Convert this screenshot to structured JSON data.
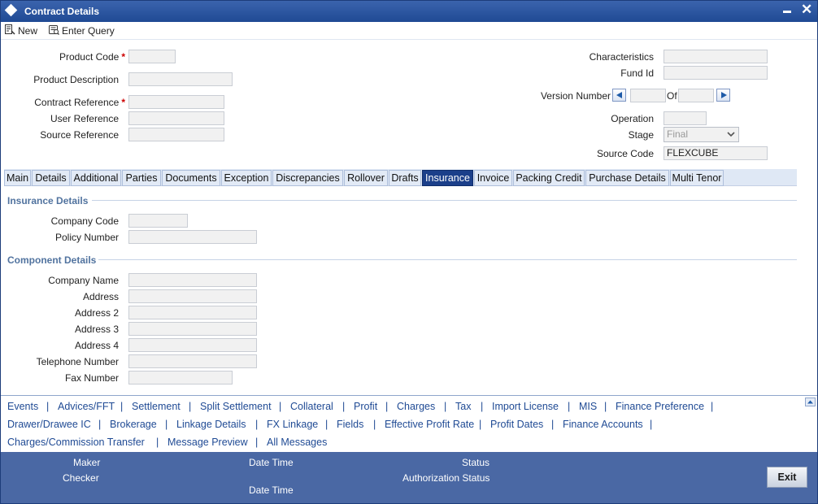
{
  "window": {
    "title": "Contract Details"
  },
  "toolbar": {
    "new_label": "New",
    "enter_query_label": "Enter Query"
  },
  "header": {
    "product_code": {
      "label": "Product Code",
      "required": "*",
      "value": ""
    },
    "product_description": {
      "label": "Product Description",
      "value": ""
    },
    "contract_reference": {
      "label": "Contract Reference",
      "required": "*",
      "value": ""
    },
    "user_reference": {
      "label": "User Reference",
      "value": ""
    },
    "source_reference": {
      "label": "Source Reference",
      "value": ""
    },
    "characteristics": {
      "label": "Characteristics",
      "value": ""
    },
    "fund_id": {
      "label": "Fund Id",
      "value": ""
    },
    "version_number": {
      "label": "Version Number",
      "of_label": "Of",
      "value": "",
      "total": ""
    },
    "operation": {
      "label": "Operation",
      "value": ""
    },
    "stage": {
      "label": "Stage",
      "value": "Final"
    },
    "source_code": {
      "label": "Source Code",
      "value": "FLEXCUBE"
    }
  },
  "tabs": [
    {
      "label": "Main"
    },
    {
      "label": "Details"
    },
    {
      "label": "Additional"
    },
    {
      "label": "Parties"
    },
    {
      "label": "Documents"
    },
    {
      "label": "Exception"
    },
    {
      "label": "Discrepancies"
    },
    {
      "label": "Rollover"
    },
    {
      "label": "Drafts"
    },
    {
      "label": "Insurance"
    },
    {
      "label": "Invoice"
    },
    {
      "label": "Packing Credit"
    },
    {
      "label": "Purchase Details"
    },
    {
      "label": "Multi Tenor"
    }
  ],
  "active_tab": "Insurance",
  "insurance": {
    "title": "Insurance Details",
    "company_code": {
      "label": "Company Code",
      "value": ""
    },
    "policy_number": {
      "label": "Policy Number",
      "value": ""
    }
  },
  "component": {
    "title": "Component Details",
    "company_name": {
      "label": "Company Name",
      "value": ""
    },
    "address": {
      "label": "Address",
      "value": ""
    },
    "address2": {
      "label": "Address 2",
      "value": ""
    },
    "address3": {
      "label": "Address 3",
      "value": ""
    },
    "address4": {
      "label": "Address 4",
      "value": ""
    },
    "telephone": {
      "label": "Telephone Number",
      "value": ""
    },
    "fax": {
      "label": "Fax Number",
      "value": ""
    }
  },
  "links": {
    "row1": [
      "Events",
      "Advices/FFT",
      "Settlement",
      "Split Settlement",
      "Collateral",
      "Profit",
      "Charges",
      "Tax",
      "Import License",
      "MIS",
      "Finance Preference"
    ],
    "row2": [
      "Drawer/Drawee IC",
      "Brokerage",
      "Linkage Details",
      "FX Linkage",
      "Fields",
      "Effective Profit Rate",
      "Profit Dates",
      "Finance Accounts"
    ],
    "row3": [
      "Charges/Commission Transfer",
      "Message Preview",
      "All Messages"
    ],
    "separator": "|"
  },
  "footer": {
    "maker": "Maker",
    "checker": "Checker",
    "date_time_1": "Date Time",
    "date_time_2": "Date Time",
    "status": "Status",
    "authorization_status": "Authorization Status",
    "exit_label": "Exit"
  }
}
